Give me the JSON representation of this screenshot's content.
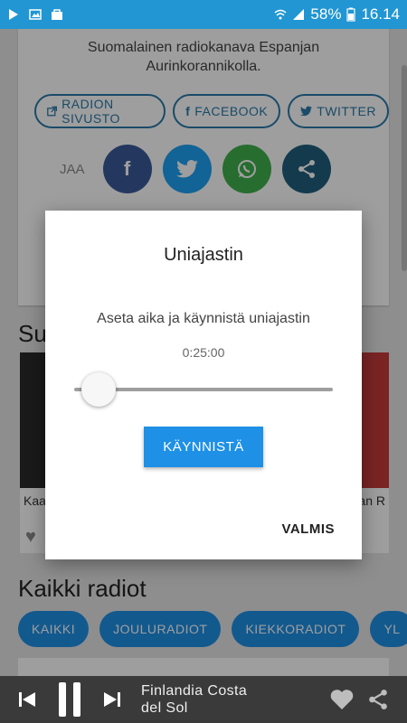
{
  "statusbar": {
    "battery": "58%",
    "time": "16.14",
    "icons": [
      "play-icon",
      "image-icon",
      "bag-icon",
      "wifi-icon",
      "signal-icon",
      "battery-icon"
    ]
  },
  "station": {
    "description_line1": "Suomalainen radiokanava Espanjan",
    "description_line2": "Aurinkorannikolla."
  },
  "links": {
    "site_label": "RADION SIVUSTO",
    "facebook_label": "FACEBOOK",
    "twitter_label": "TWITTER"
  },
  "share": {
    "label": "JAA",
    "icons": [
      "facebook-icon",
      "twitter-icon",
      "whatsapp-icon",
      "share-icon"
    ]
  },
  "sections": {
    "suggested_partial": "Su",
    "tile_left_caption": "Kaa",
    "tile_right_caption": "dan R",
    "all_radios": "Kaikki radiot"
  },
  "chips": [
    "KAIKKI",
    "JOULURADIOT",
    "KIEKKORADIOT",
    "YL"
  ],
  "dialog": {
    "title": "Uniajastin",
    "subtitle": "Aseta aika ja käynnistä uniajastin",
    "time_value": "0:25:00",
    "slider_level": 0.1,
    "start_label": "KÄYNNISTÄ",
    "done_label": "VALMIS"
  },
  "player": {
    "station_line1": "Finlandia Costa",
    "station_line2": "del Sol"
  },
  "colors": {
    "accent": "#1e90e6",
    "statusbar": "#2196d3",
    "player_bg": "#3a3a3a"
  }
}
